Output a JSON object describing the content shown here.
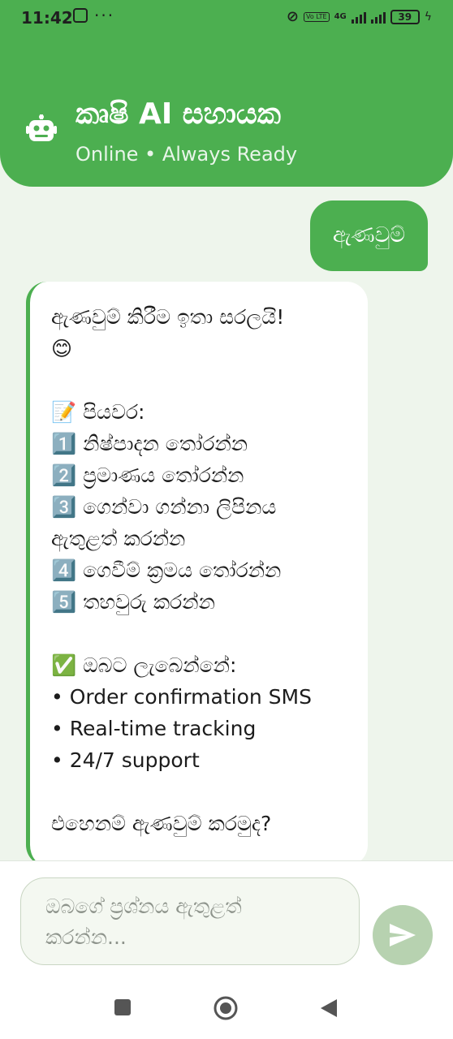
{
  "status_bar": {
    "time": "11:42",
    "dots": "···",
    "network": "4G",
    "volte": "Vo LTE",
    "battery": "39"
  },
  "header": {
    "title": "කෘෂි AI සහායක",
    "subtitle": "Online • Always Ready",
    "avatar_icon": "robot-icon"
  },
  "chat": {
    "user_message": "ඇණවුම්",
    "bot_message_lines": [
      "ඇණවුම් කිරීම ඉතා සරලයි!",
      "😊",
      "",
      "📝 පියවර:",
      "1️⃣ නිෂ්පාදන තෝරන්න",
      "2️⃣ ප්‍රමාණය තෝරන්න",
      "3️⃣ ගෙන්වා ගන්නා ලිපිනය",
      "ඇතුළත් කරන්න",
      "4️⃣ ගෙවීම් ක්‍රමය තෝරන්න",
      "5️⃣ තහවුරු කරන්න",
      "",
      "✅ ඔබට ලැබෙන්නේ:",
      "• Order confirmation SMS",
      "• Real-time tracking",
      "• 24/7 support",
      "",
      "එහෙනම් ඇණවුම් කරමුද?"
    ]
  },
  "input": {
    "placeholder_line1": "ඔබගේ ප්‍රශ්නය ඇතුළත්",
    "placeholder_line2": "කරන්න...",
    "send_icon": "send-icon"
  },
  "colors": {
    "primary": "#4caf50",
    "background": "#eef5ec",
    "send_disabled": "#b7d2b0"
  }
}
